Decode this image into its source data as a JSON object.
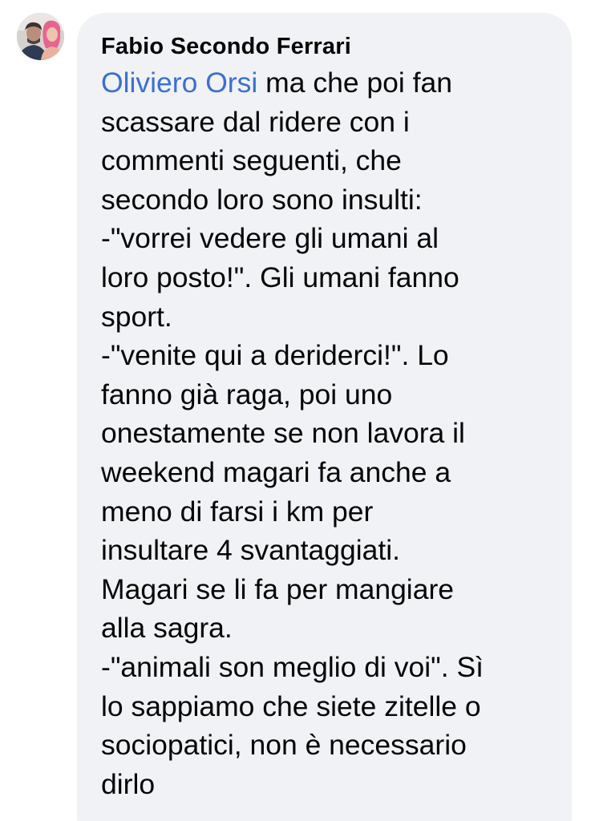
{
  "comment": {
    "author": "Fabio Secondo Ferrari",
    "mention": "Oliviero Orsi",
    "text": " ma che poi fan\nscassare dal ridere con i\ncommenti seguenti, che\nsecondo loro sono insulti:\n-\"vorrei vedere gli umani al\nloro posto!\". Gli umani fanno\nsport.\n-\"venite qui a deriderci!\". Lo\nfanno già raga, poi uno\nonestamente se non lavora il\nweekend magari fa anche a\nmeno di farsi i km per\ninsultare 4 svantaggiati.\nMagari se li fa per mangiare\nalla sagra.\n-\"animali son meglio di voi\". Sì\nlo sappiamo che siete zitelle o\nsociopatici, non è necessario\ndirlo"
  },
  "colors": {
    "bubble": "#f0f2f5",
    "text": "#050505",
    "mention": "#3b6fd4"
  },
  "icons": {
    "avatar": "profile-photo"
  }
}
